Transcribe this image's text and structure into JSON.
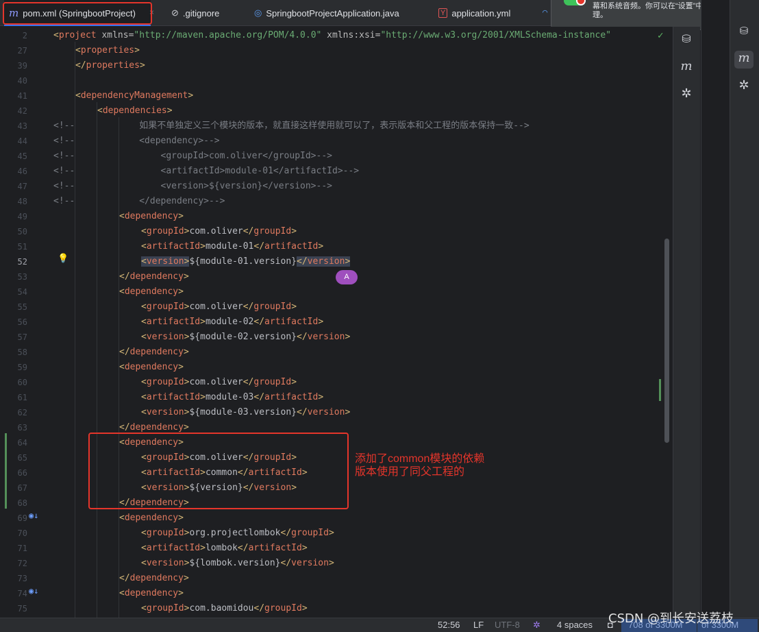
{
  "tabs": [
    {
      "label": "pom.xml (SpringbootProject)",
      "icon": "maven-icon",
      "active": true
    },
    {
      "label": ".gitignore",
      "icon": "ignore-file-icon"
    },
    {
      "label": "SpringbootProjectApplication.java",
      "icon": "spring-boot-icon"
    },
    {
      "label": "application.yml",
      "icon": "yaml-icon"
    }
  ],
  "tab_close": "×",
  "notification": {
    "text": "幕和系统音频。你可以在“设置”中进行管\n理。"
  },
  "editor": {
    "lines": [
      {
        "n": "2",
        "ind": 0,
        "kind": "project"
      },
      {
        "n": "27",
        "ind": 1,
        "kind": "open",
        "name": "properties"
      },
      {
        "n": "39",
        "ind": 1,
        "kind": "close",
        "name": "properties"
      },
      {
        "n": "40",
        "ind": 0,
        "kind": "blank"
      },
      {
        "n": "41",
        "ind": 1,
        "kind": "open",
        "name": "dependencyManagement"
      },
      {
        "n": "42",
        "ind": 2,
        "kind": "open",
        "name": "dependencies"
      },
      {
        "n": "43",
        "ind": 0,
        "kind": "comment",
        "text": "<!--            如果不单独定义三个模块的版本，就直接这样使用就可以了，表示版本和父工程的版本保持一致-->"
      },
      {
        "n": "44",
        "ind": 0,
        "kind": "comment",
        "text": "<!--            <dependency>-->"
      },
      {
        "n": "45",
        "ind": 0,
        "kind": "comment",
        "text": "<!--                <groupId>com.oliver</groupId>-->"
      },
      {
        "n": "46",
        "ind": 0,
        "kind": "comment",
        "text": "<!--                <artifactId>module-01</artifactId>-->"
      },
      {
        "n": "47",
        "ind": 0,
        "kind": "comment",
        "text": "<!--                <version>${version}</version>-->"
      },
      {
        "n": "48",
        "ind": 0,
        "kind": "comment",
        "text": "<!--            </dependency>-->"
      },
      {
        "n": "49",
        "ind": 3,
        "kind": "open",
        "name": "dependency"
      },
      {
        "n": "50",
        "ind": 4,
        "kind": "elem",
        "name": "groupId",
        "value": "com.oliver"
      },
      {
        "n": "51",
        "ind": 4,
        "kind": "elem",
        "name": "artifactId",
        "value": "module-01"
      },
      {
        "n": "52",
        "ind": 4,
        "kind": "elem",
        "name": "version",
        "value": "${module-01.version}",
        "current": true
      },
      {
        "n": "53",
        "ind": 3,
        "kind": "close",
        "name": "dependency"
      },
      {
        "n": "54",
        "ind": 3,
        "kind": "open",
        "name": "dependency"
      },
      {
        "n": "55",
        "ind": 4,
        "kind": "elem",
        "name": "groupId",
        "value": "com.oliver"
      },
      {
        "n": "56",
        "ind": 4,
        "kind": "elem",
        "name": "artifactId",
        "value": "module-02"
      },
      {
        "n": "57",
        "ind": 4,
        "kind": "elem",
        "name": "version",
        "value": "${module-02.version}"
      },
      {
        "n": "58",
        "ind": 3,
        "kind": "close",
        "name": "dependency"
      },
      {
        "n": "59",
        "ind": 3,
        "kind": "open",
        "name": "dependency"
      },
      {
        "n": "60",
        "ind": 4,
        "kind": "elem",
        "name": "groupId",
        "value": "com.oliver"
      },
      {
        "n": "61",
        "ind": 4,
        "kind": "elem",
        "name": "artifactId",
        "value": "module-03"
      },
      {
        "n": "62",
        "ind": 4,
        "kind": "elem",
        "name": "version",
        "value": "${module-03.version}"
      },
      {
        "n": "63",
        "ind": 3,
        "kind": "close",
        "name": "dependency"
      },
      {
        "n": "64",
        "ind": 3,
        "kind": "open",
        "name": "dependency"
      },
      {
        "n": "65",
        "ind": 4,
        "kind": "elem",
        "name": "groupId",
        "value": "com.oliver"
      },
      {
        "n": "66",
        "ind": 4,
        "kind": "elem",
        "name": "artifactId",
        "value": "common"
      },
      {
        "n": "67",
        "ind": 4,
        "kind": "elem",
        "name": "version",
        "value": "${version}"
      },
      {
        "n": "68",
        "ind": 3,
        "kind": "close",
        "name": "dependency"
      },
      {
        "n": "69",
        "ind": 3,
        "kind": "open",
        "name": "dependency"
      },
      {
        "n": "70",
        "ind": 4,
        "kind": "elem",
        "name": "groupId",
        "value": "org.projectlombok"
      },
      {
        "n": "71",
        "ind": 4,
        "kind": "elem",
        "name": "artifactId",
        "value": "lombok"
      },
      {
        "n": "72",
        "ind": 4,
        "kind": "elem",
        "name": "version",
        "value": "${lombok.version}"
      },
      {
        "n": "73",
        "ind": 3,
        "kind": "close",
        "name": "dependency"
      },
      {
        "n": "74",
        "ind": 3,
        "kind": "open",
        "name": "dependency"
      },
      {
        "n": "75",
        "ind": 4,
        "kind": "elem",
        "name": "groupId",
        "value": "com.baomidou"
      }
    ],
    "project_line": {
      "tag": "project",
      "attr1": "xmlns",
      "val1": "\"http://maven.apache.org/POM/4.0.0\"",
      "attr2": "xmlns:xsi",
      "val2": "\"http://www.w3.org/2001/XMLSchema-instance\""
    },
    "avatar_letter": "A"
  },
  "annotation": "添加了common模块的依赖\n版本使用了同父工程的",
  "status": {
    "position": "52:56",
    "line_sep": "LF",
    "encoding": "UTF-8",
    "indent": "4 spaces",
    "memory": "708 of 3300M",
    "memory2": "of 3300M"
  },
  "watermark": "CSDN @到长安送荔枝"
}
